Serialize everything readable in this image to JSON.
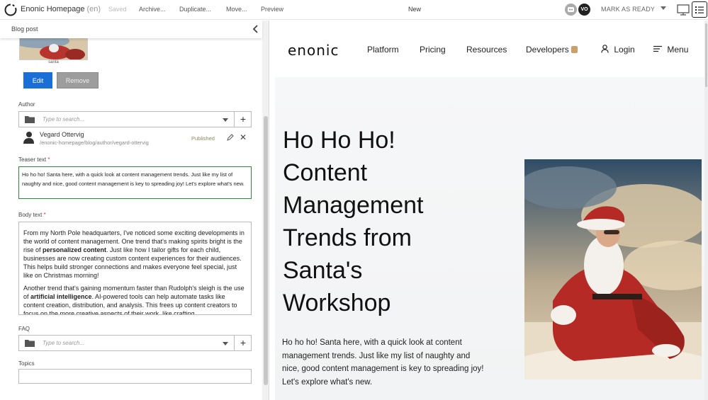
{
  "toolbar": {
    "title": "Enonic Homepage",
    "lang": "(en)",
    "saved": "Saved",
    "archive": "Archive...",
    "duplicate": "Duplicate...",
    "move": "Move...",
    "preview": "Preview",
    "status_center": "New",
    "avatar_initials": "VO",
    "mark_ready": "MARK AS READY"
  },
  "form": {
    "header": "Blog post",
    "image_caption": "santa",
    "edit_label": "Edit",
    "remove_label": "Remove",
    "author_label": "Author",
    "search_placeholder": "Type to search...",
    "author": {
      "name": "Vegard Ottervig",
      "path": "/enonic-homepage/blog/author/vegard-ottervig",
      "status": "Published"
    },
    "teaser_label": "Teaser text",
    "teaser_value": "Ho ho ho! Santa here, with a quick look at content management trends. Just like my list of naughty and nice, good content management is key to spreading joy! Let's explore what's new.",
    "body_label": "Body text",
    "body": {
      "p1_a": "From my North Pole headquarters, I've noticed some exciting developments in the world of content management. One trend that's making spirits bright is the rise of ",
      "p1_bold": "personalized content",
      "p1_b": ". Just like how I tailor gifts for each child, businesses are now creating custom content experiences for their audiences. This helps build stronger connections and makes everyone feel special, just like on Christmas morning!",
      "p2_a": "Another trend that's gaining momentum faster than Rudolph's sleigh is the use of ",
      "p2_bold": "artificial intelligence",
      "p2_b": ". AI-powered tools can help automate tasks like content creation, distribution, and analysis. This frees up content creators to focus on the more creative aspects of their work, like crafting"
    },
    "faq_label": "FAQ",
    "topics_label": "Topics",
    "required_mark": "*"
  },
  "preview": {
    "brand": "enonic",
    "nav": {
      "platform": "Platform",
      "pricing": "Pricing",
      "resources": "Resources",
      "developers": "Developers",
      "login": "Login",
      "menu": "Menu"
    },
    "title_lines": [
      "Ho Ho Ho!",
      "Content",
      "Management",
      "Trends from",
      "Santa's",
      "Workshop"
    ],
    "description": "Ho ho ho! Santa here, with a quick look at content management trends. Just like my list of naughty and nice, good content management is key to spreading joy! Let's explore what's new."
  },
  "colors": {
    "primary_button": "#1a6fd7",
    "remove_button": "#9d9d9d",
    "active_field_border": "#2c8a3c",
    "published": "#8a8a5c"
  }
}
